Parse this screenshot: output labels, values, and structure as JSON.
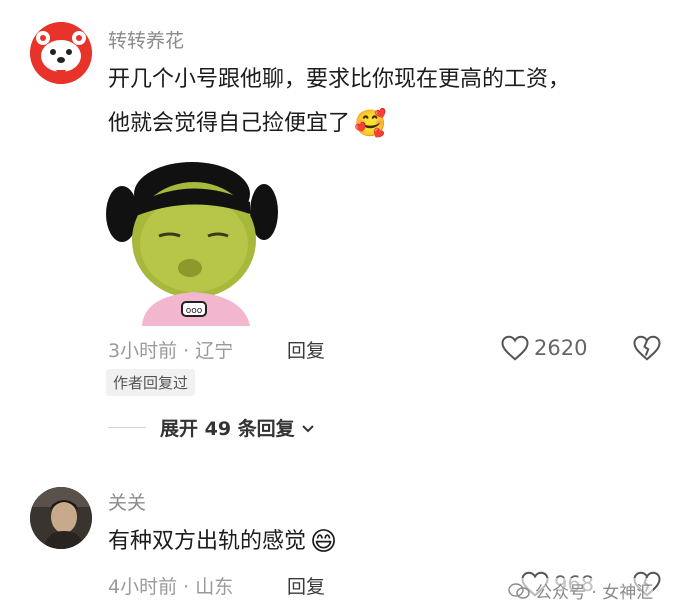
{
  "comments": [
    {
      "username": "转转养花",
      "text_lines": [
        "开几个小号跟他聊，要求比你现在更高的工资，",
        "他就会觉得自己捡便宜了"
      ],
      "emoji": "🥰",
      "time_location": "3小时前 · 辽宁",
      "reply_label": "回复",
      "likes": "2620",
      "author_badge": "作者回复过",
      "expand_label": "展开 49 条回复"
    },
    {
      "username": "关关",
      "text_lines": [
        "有种双方出轨的感觉"
      ],
      "emoji": "😄",
      "time_location": "4小时前 · 山东",
      "reply_label": "回复",
      "likes": "968"
    }
  ],
  "watermark": "公众号 · 女神汇",
  "icons": [
    "heart-icon",
    "broken-heart-icon",
    "chevron-down-icon",
    "wechat-icon"
  ],
  "colors": {
    "avatar1_bg": "#e8332a",
    "meme_face": "#a8b83a",
    "meme_shirt": "#f3b6cf"
  }
}
